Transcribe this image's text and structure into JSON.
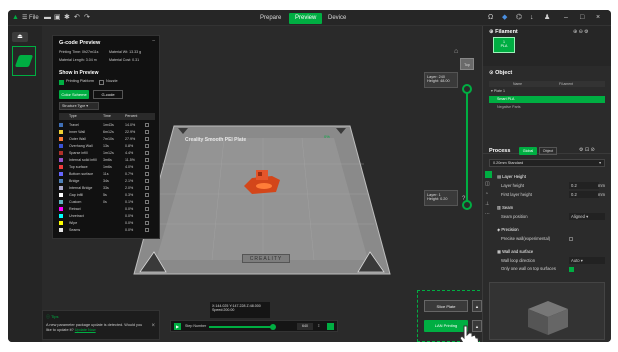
{
  "topbar": {
    "menu_label": "File",
    "tabs": [
      "Prepare",
      "Preview",
      "Device"
    ],
    "active_tab": "Preview",
    "win_controls": [
      "–",
      "□",
      "×"
    ]
  },
  "gcode_preview": {
    "title": "G-code Preview",
    "print_time_label": "Printing Time: 0h27m11s",
    "material_weight_label": "Material Wt: 13.33 g",
    "material_length_label": "Material Length: 3.04 m",
    "material_cost_label": "Material Cost: 0.31",
    "show_in_preview": "Show in Preview",
    "printing_platform": "Printing Platform",
    "nozzle": "Nozzle",
    "color_scheme": "Color Scheme",
    "gcode_btn": "G-code",
    "structure_type": "Structure Type",
    "headers": [
      "Type",
      "Time",
      "Percent"
    ],
    "rows": [
      {
        "type": "Travel",
        "time": "1m43s",
        "percent": "14.0%",
        "color": "#3f6fb5"
      },
      {
        "type": "Inner Wall",
        "time": "6m12s",
        "percent": "22.9%",
        "color": "#f0d234"
      },
      {
        "type": "Outer Wall",
        "time": "7m10s",
        "percent": "27.9%",
        "color": "#ff7d38"
      },
      {
        "type": "Overhang Wall",
        "time": "13s",
        "percent": "0.8%",
        "color": "#3a52d6"
      },
      {
        "type": "Sparse infill",
        "time": "1m12s",
        "percent": "4.4%",
        "color": "#b03029"
      },
      {
        "type": "Internal solid infill",
        "time": "3m6s",
        "percent": "11.5%",
        "color": "#9654cc"
      },
      {
        "type": "Top surface",
        "time": "1m6s",
        "percent": "4.0%",
        "color": "#f03c3c"
      },
      {
        "type": "Bottom surface",
        "time": "11s",
        "percent": "0.7%",
        "color": "#6666ff"
      },
      {
        "type": "Bridge",
        "time": "34s",
        "percent": "2.1%",
        "color": "#4d80ba"
      },
      {
        "type": "Internal Bridge",
        "time": "33s",
        "percent": "2.0%",
        "color": "#aaaacc"
      },
      {
        "type": "Gap infill",
        "time": "5s",
        "percent": "0.3%",
        "color": "#ffffff"
      },
      {
        "type": "Custom",
        "time": "0s",
        "percent": "0.1%",
        "color": "#5cb3bf"
      },
      {
        "type": "Retract",
        "time": "",
        "percent": "0.0%",
        "color": "#ff00ff"
      },
      {
        "type": "Unretract",
        "time": "",
        "percent": "0.0%",
        "color": "#00ffff"
      },
      {
        "type": "Wipe",
        "time": "",
        "percent": "0.0%",
        "color": "#ffff00"
      },
      {
        "type": "Seams",
        "time": "",
        "percent": "0.0%",
        "color": "#e6e6e6"
      }
    ]
  },
  "viewport": {
    "plate_title": "Creality Smooth PEI Plate",
    "plate_brand": "CREALITY",
    "layer_top": "Layer: 240",
    "height_top": "Height: 48.00",
    "layer_bottom": "Layer: 1",
    "height_bottom": "Height: 0.20",
    "progress_pct": "0%",
    "coords": "X:144.025 Y:147.228 Z:48.000",
    "speed": "Speed:200.00",
    "step_label": "Step Number",
    "step_value": "640",
    "tip_title": "Tips",
    "tip_text": "A new parameter package update is detected. Would you like to update it?",
    "tip_link": "Update Now",
    "slice_label": "Slice Plate",
    "print_label": "LAN Printing"
  },
  "panel": {
    "filament_title": "Filament",
    "filament_sub": "PLA",
    "object_title": "Object",
    "obj_headers": [
      "Name",
      "Fil.ament"
    ],
    "plate_row": "Plate 1",
    "object_row": "Smart PLA",
    "negative_row": "Negative Parts",
    "process_title": "Process",
    "global_btn": "Global",
    "object_btn": "Object",
    "preset": "0.20mm Standard",
    "layer_height": "Layer Height",
    "layer_height_lbl": "Layer height",
    "layer_height_val": "0.2",
    "first_layer": "First layer height",
    "first_layer_val": "0.2",
    "unit": "mm",
    "seam": "Seam",
    "seam_position": "Seam position",
    "seam_val": "Aligned",
    "precision": "Precision",
    "precise_wall": "Precise wall(experimental)",
    "wall_surface": "Wall and surface",
    "wall_direction": "Wall loop direction",
    "wall_direction_val": "Auto",
    "only_one_wall": "Only one wall on top surfaces"
  },
  "colors": {
    "accent": "#00ae42",
    "bg": "#1e1e1e"
  }
}
